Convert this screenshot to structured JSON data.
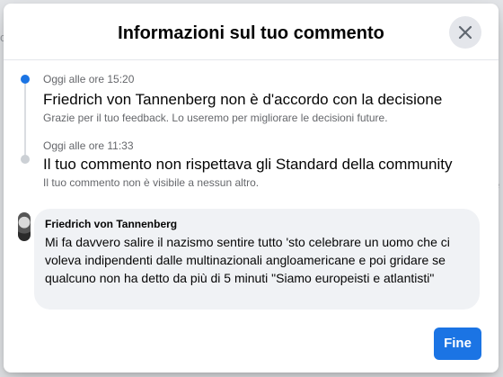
{
  "dialog": {
    "title": "Informazioni sul tuo commento",
    "close_icon": "close-icon"
  },
  "timeline": [
    {
      "time": "Oggi alle ore 15:20",
      "headline": "Friedrich von Tannenberg non è d'accordo con la decisione",
      "subtext": "Grazie per il tuo feedback. Lo useremo per migliorare le decisioni future.",
      "dot_color": "#1b74e4"
    },
    {
      "time": "Oggi alle ore 11:33",
      "headline": "Il tuo commento non rispettava gli Standard della community",
      "subtext": "Il tuo commento non è visibile a nessun altro.",
      "dot_color": "#ccd0d5"
    }
  ],
  "comment": {
    "author": "Friedrich von Tannenberg",
    "text": "Mi fa davvero salire il nazismo sentire tutto 'sto celebrare un uomo che ci voleva indipendenti dalle multinazionali angloamericane e poi gridare se qualcuno non ha detto da più di 5 minuti \"Siamo europeisti e atlantisti\""
  },
  "actions": {
    "done_label": "Fine",
    "accent": "#1b74e4"
  }
}
